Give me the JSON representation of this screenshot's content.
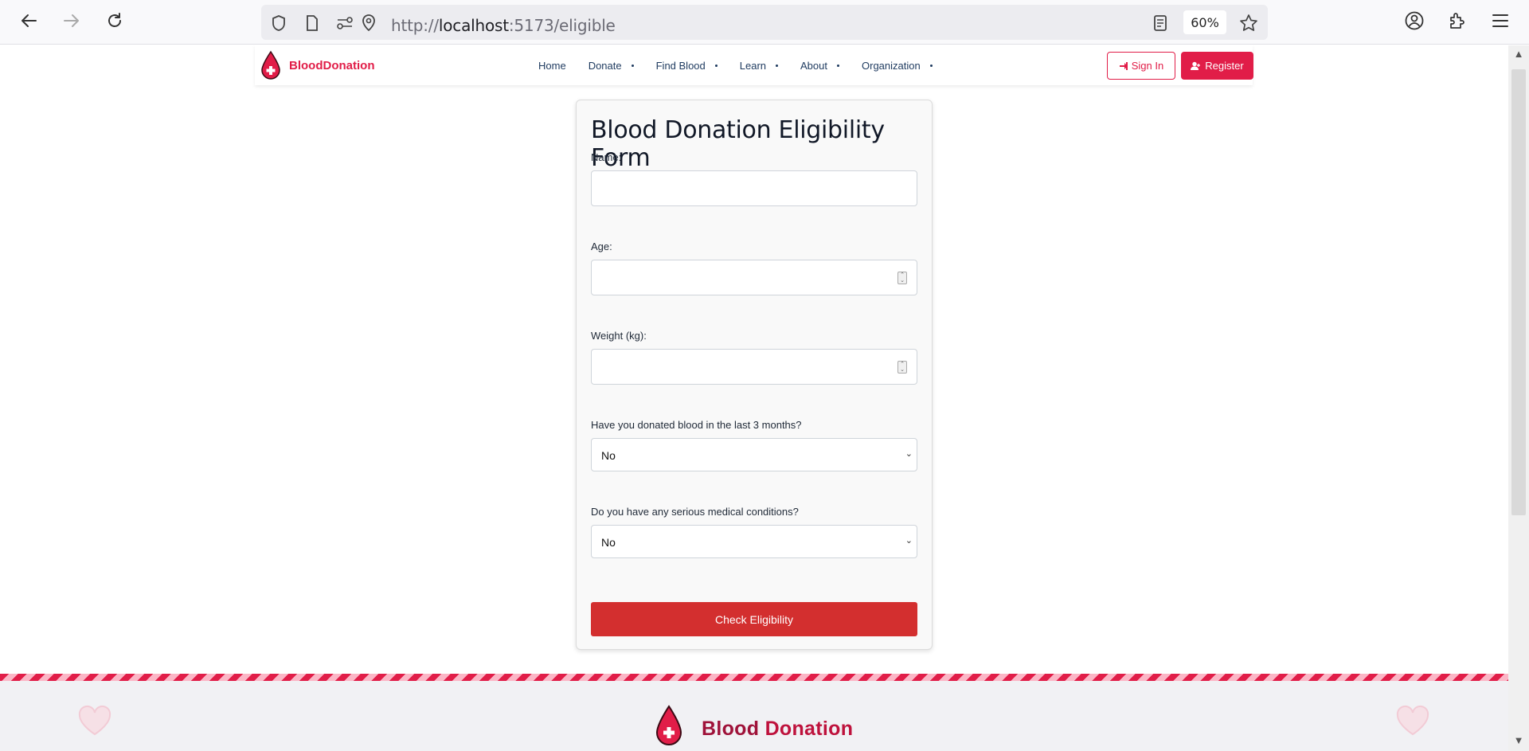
{
  "browser": {
    "url_prefix": "http://",
    "url_host": "localhost",
    "url_rest": ":5173/eligible",
    "zoom": "60%"
  },
  "nav": {
    "brand": "BloodDonation",
    "menu": [
      "Home",
      "Donate",
      "Find Blood",
      "Learn",
      "About",
      "Organization"
    ],
    "sign_in": "Sign In",
    "register": "Register"
  },
  "form": {
    "title": "Blood Donation Eligibility Form",
    "name_label": "Name:",
    "age_label": "Age:",
    "weight_label": "Weight (kg):",
    "donated_label": "Have you donated blood in the last 3 months?",
    "donated_value": "No",
    "medical_label": "Do you have any serious medical conditions?",
    "medical_value": "No",
    "submit_label": "Check Eligibility"
  },
  "footer": {
    "brand_part1": "Blood ",
    "brand_part2": "Donation"
  },
  "colors": {
    "brand": "#e11d48",
    "submit": "#d32f2f",
    "nav_text": "#1e3a5f"
  }
}
